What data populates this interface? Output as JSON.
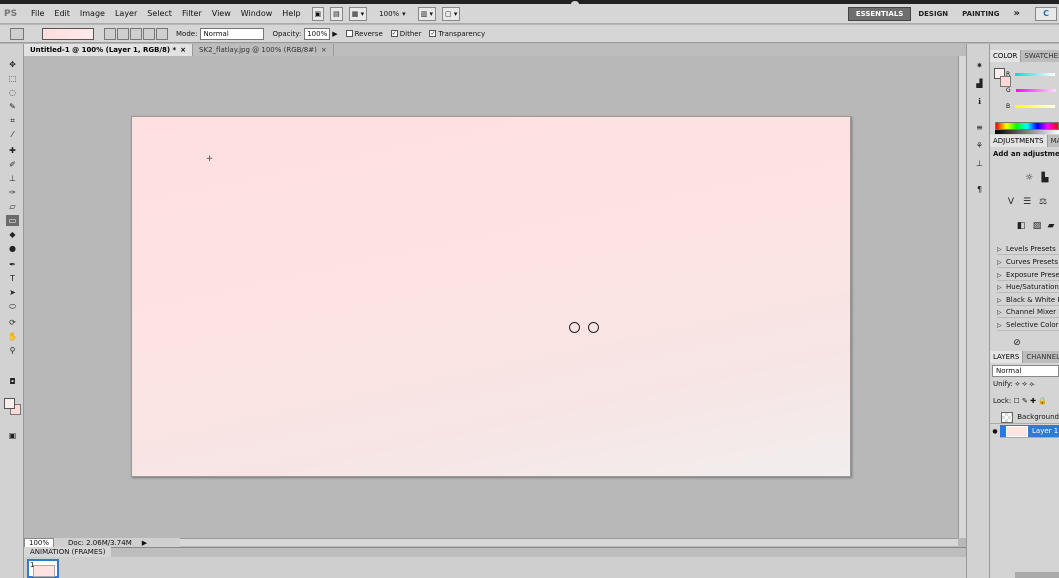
{
  "app": {
    "logo": "PS"
  },
  "menubar": {
    "items": [
      "File",
      "Edit",
      "Image",
      "Layer",
      "Select",
      "Filter",
      "View",
      "Window",
      "Help"
    ],
    "zoom": "100%",
    "workspaces": [
      "ESSENTIALS",
      "DESIGN",
      "PAINTING"
    ],
    "more": "»",
    "cs_live": "C"
  },
  "options": {
    "mode_label": "Mode:",
    "mode_value": "Normal",
    "opacity_label": "Opacity:",
    "opacity_value": "100%",
    "reverse_label": "Reverse",
    "dither_label": "Dither",
    "transparency_label": "Transparency",
    "dither_checked": "✓",
    "transparency_checked": "✓"
  },
  "tabs": [
    {
      "label": "Untitled-1 @ 100% (Layer 1, RGB/8) *",
      "close": "×"
    },
    {
      "label": "SK2_flatlay.jpg @ 100% (RGB/8#)",
      "close": "×"
    }
  ],
  "status": {
    "zoom": "100%",
    "doc": "Doc: 2.06M/3.74M",
    "arrow": "▶"
  },
  "animation": {
    "title": "ANIMATION (FRAMES)",
    "frame_number": "1"
  },
  "panels": {
    "color": {
      "tabs": [
        "COLOR",
        "SWATCHES"
      ],
      "channels": [
        "R",
        "G",
        "B"
      ]
    },
    "adjustments": {
      "tabs": [
        "ADJUSTMENTS",
        "MASKS"
      ],
      "title": "Add an adjustment",
      "presets": [
        "Levels Presets",
        "Curves Presets",
        "Exposure Presets",
        "Hue/Saturation Presets",
        "Black & White Presets",
        "Channel Mixer Presets",
        "Selective Color Presets"
      ]
    },
    "layers": {
      "tabs": [
        "LAYERS",
        "CHANNELS"
      ],
      "blend_mode": "Normal",
      "unify_label": "Unify:",
      "lock_label": "Lock:",
      "layers": [
        {
          "name": "Background",
          "visible": ""
        },
        {
          "name": "Layer 1",
          "visible": "●"
        }
      ]
    }
  },
  "colors": {
    "accent": "#2f7bd1",
    "canvas_top": "#ffdfdf",
    "canvas_bottom": "#f2eeee"
  }
}
